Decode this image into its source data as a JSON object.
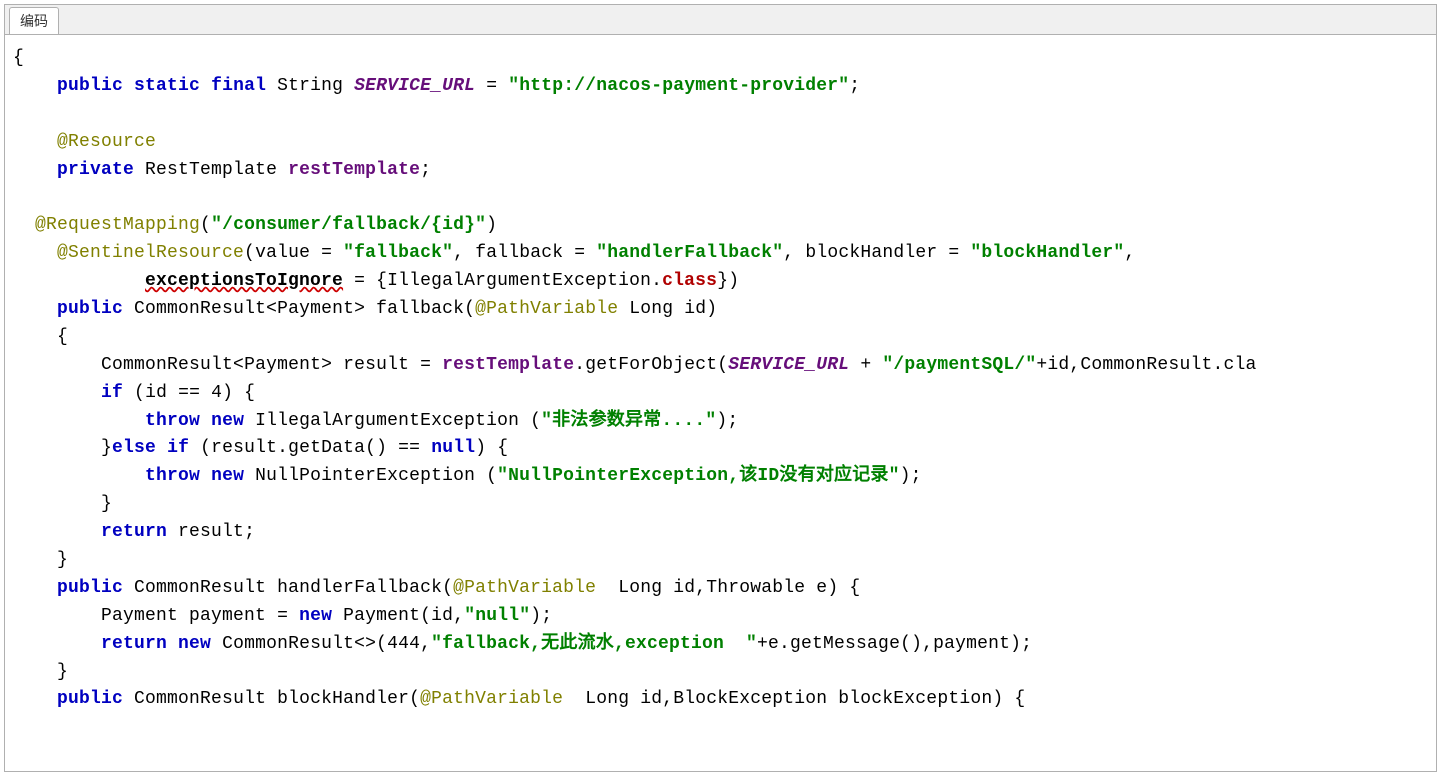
{
  "tab": {
    "label": "编码"
  },
  "code": {
    "kw_public": "public",
    "kw_static": "static",
    "kw_final": "final",
    "kw_private": "private",
    "kw_if": "if",
    "kw_else": "else",
    "kw_return": "return",
    "kw_throw": "throw",
    "kw_new": "new",
    "kw_null": "null",
    "kw_class": "class",
    "type_String": "String",
    "type_RestTemplate": "RestTemplate",
    "type_CommonResult": "CommonResult",
    "type_Payment": "Payment",
    "type_Long": "Long",
    "type_Throwable": "Throwable",
    "type_BlockException": "BlockException",
    "type_IllegalArgumentException": "IllegalArgumentException",
    "type_NullPointerException": "NullPointerException",
    "field_SERVICE_URL": "SERVICE_URL",
    "field_restTemplate": "restTemplate",
    "str_serviceUrl": "\"http://nacos-payment-provider\"",
    "str_mapping": "\"/consumer/fallback/{id}\"",
    "str_fallback_val": "\"fallback\"",
    "str_handlerFallback": "\"handlerFallback\"",
    "str_blockHandler": "\"blockHandler\"",
    "str_paymentSQL": "\"/paymentSQL/\"",
    "str_illegalArg": "\"非法参数异常....\"",
    "str_npe": "\"NullPointerException,该ID没有对应记录\"",
    "str_nullLit": "\"null\"",
    "str_fallbackMsg": "\"fallback,无此流水,exception  \"",
    "ann_Resource": "@Resource",
    "ann_RequestMapping": "@RequestMapping",
    "ann_SentinelResource": "@SentinelResource",
    "ann_PathVariable": "@PathVariable",
    "attr_value": "value",
    "attr_fallback": "fallback",
    "attr_blockHandler": "blockHandler",
    "attr_exceptionsToIgnore": "exceptionsToIgnore",
    "method_fallback": "fallback",
    "method_handlerFallback": "handlerFallback",
    "method_blockHandler": "blockHandler",
    "method_getForObject": "getForObject",
    "method_getData": "getData",
    "method_getMessage": "getMessage",
    "var_id": "id",
    "var_result": "result",
    "var_e": "e",
    "var_payment": "payment",
    "var_blockException": "blockException",
    "num_4": "4",
    "num_444": "444",
    "dot_cla": "cla"
  }
}
